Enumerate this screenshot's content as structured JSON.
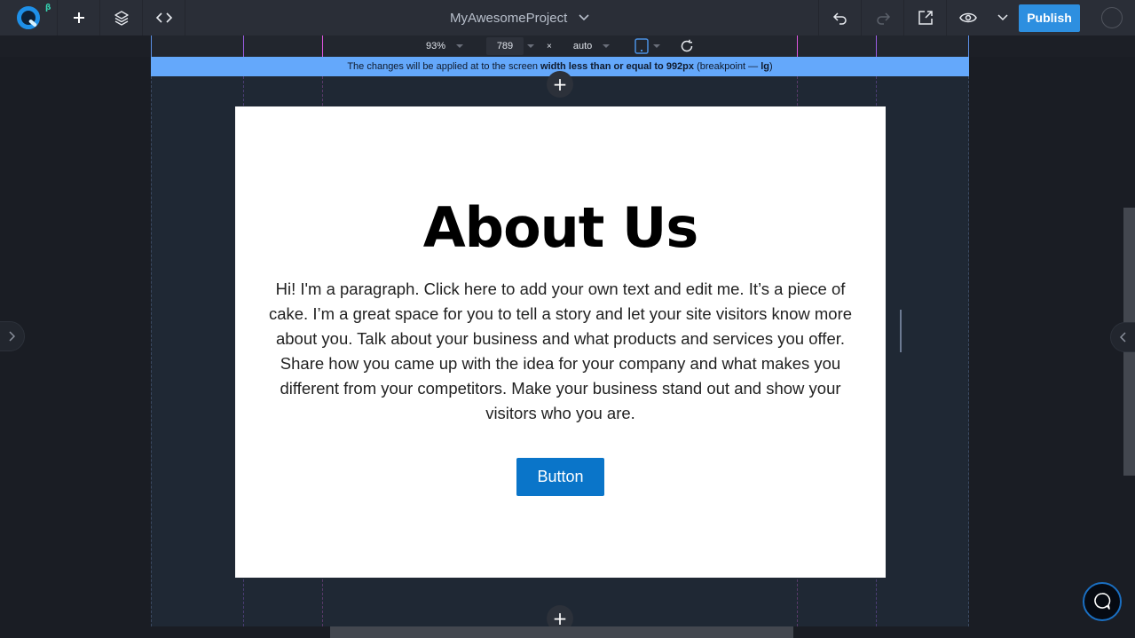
{
  "app": {
    "logo_badge": "β",
    "project_title": "MyAwesomeProject"
  },
  "toolbar_left": [
    {
      "icon": "plus-icon",
      "label": "Add"
    },
    {
      "icon": "layers-icon",
      "label": "Layers"
    },
    {
      "icon": "code-icon",
      "label": "Code"
    }
  ],
  "toolbar_right": {
    "undo_icon": "undo-icon",
    "redo_icon": "redo-icon",
    "export_icon": "external-link-icon",
    "preview_icon": "eye-icon",
    "publish_label": "Publish"
  },
  "viewport": {
    "zoom": "93%",
    "width": "789",
    "times": "×",
    "height": "auto",
    "device_icon": "tablet-icon",
    "refresh_icon": "refresh-icon"
  },
  "banner": {
    "prefix": "The changes will be applied at to the screen ",
    "bold_condition": "width less than or equal to 992px",
    "paren_open": " (breakpoint — ",
    "breakpoint": "lg",
    "paren_close": ")"
  },
  "page": {
    "heading": "About Us",
    "paragraph": "Hi! I'm a paragraph. Click here to add your own text and edit me. It’s a piece of cake. I’m a great space for you to tell a story and let your site visitors know more about you. Talk about your business and what products and services you offer. Share how you came up with the idea for your company and what makes you different from your competitors. Make your business stand out and show your visitors who you are.",
    "button_label": "Button"
  },
  "add_section_symbol": "+",
  "colors": {
    "accent": "#2d8fe0",
    "banner": "#64a8fb",
    "cta": "#0a75c9",
    "guide_blue": "#5b8fe6",
    "guide_purple": "#9b5de5",
    "guide_pink": "#e055e0"
  }
}
